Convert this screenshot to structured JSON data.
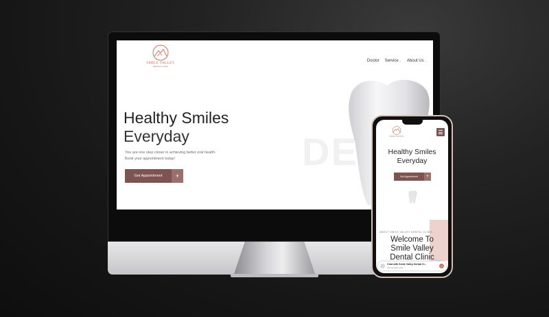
{
  "brand": {
    "name": "SMILE VALLEY",
    "tagline": "DENTAL CLINIC",
    "color": "#c8735a"
  },
  "nav": {
    "items": [
      {
        "label": "Doctor",
        "has_dropdown": false
      },
      {
        "label": "Service",
        "has_dropdown": true
      },
      {
        "label": "About Us",
        "has_dropdown": true
      }
    ]
  },
  "hero": {
    "title_line1": "Healthy Smiles",
    "title_line2": "Everyday",
    "body_line1": "You are one step closer in achieving better oral health.",
    "body_line2": "Book your appointment today!",
    "cta_label": "Get Appointment",
    "cta_icon": "+",
    "background_word": "DE",
    "accent": "#7d5450"
  },
  "mobile": {
    "about_label": "ABOUT SMILE VALLEY DENTAL CLINIC",
    "welcome_line1": "Welcome To",
    "welcome_line2": "Smile Valley",
    "welcome_line3": "Dental Clinic",
    "chat_title": "Chat with Smile Valley Dental Cl...",
    "chat_subtitle": "We typically reply...",
    "chat_close": "×"
  }
}
